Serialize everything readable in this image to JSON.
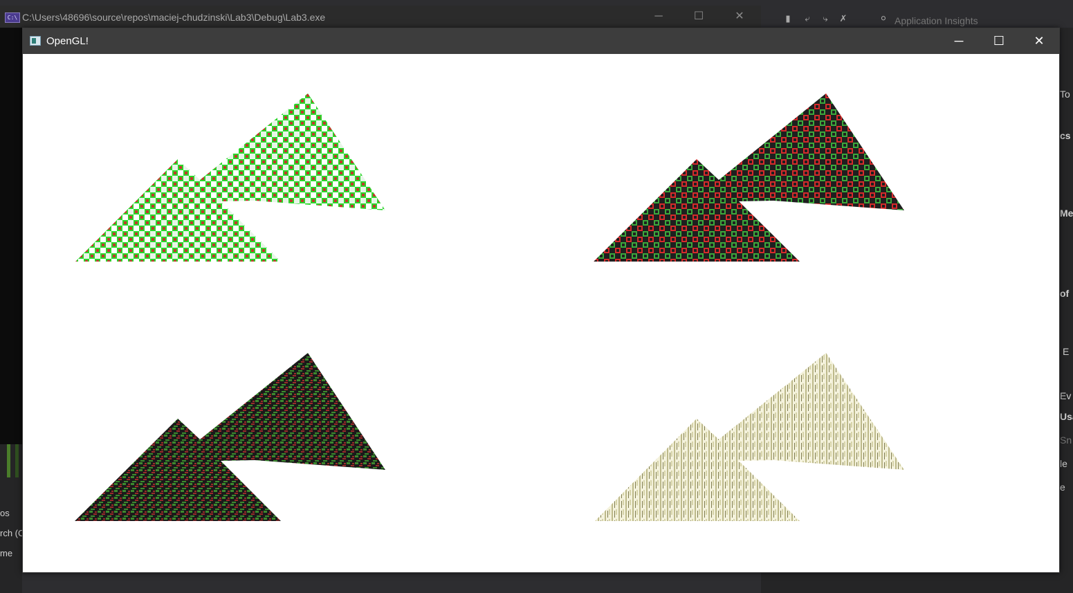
{
  "ide": {
    "toolbar_label": "Application Insights",
    "right_strip_items": [
      "To",
      "cs",
      "Me",
      "of",
      "E",
      "Ev",
      "Usa",
      "Sn",
      "le",
      "e"
    ],
    "left_panel_items": [
      "os",
      "rch (C",
      "me"
    ]
  },
  "console_window": {
    "title": "C:\\Users\\48696\\source\\repos\\maciej-chudzinski\\Lab3\\Debug\\Lab3.exe",
    "icon_text": "C:\\",
    "minimize_glyph": "─",
    "maximize_glyph": "☐",
    "close_glyph": "✕"
  },
  "gl_window": {
    "title": "OpenGL!",
    "minimize_glyph": "─",
    "maximize_glyph": "☐",
    "close_glyph": "✕"
  },
  "render": {
    "background": "#ffffff",
    "viewports": [
      {
        "name": "top-left",
        "style": "checker",
        "colors": [
          "#ffffff",
          "#2bd62b",
          "#c0392b"
        ]
      },
      {
        "name": "top-right",
        "style": "checker",
        "colors": [
          "#1f1f1f",
          "#3ca83c",
          "#d62b2b"
        ]
      },
      {
        "name": "bottom-left",
        "style": "noise",
        "colors": [
          "#1a1a1a",
          "#3c8a2e",
          "#9b2a2a"
        ]
      },
      {
        "name": "bottom-right",
        "style": "streaks",
        "colors": [
          "#f4f2dc",
          "#bdb98a",
          "#7d7a4c"
        ]
      }
    ]
  }
}
